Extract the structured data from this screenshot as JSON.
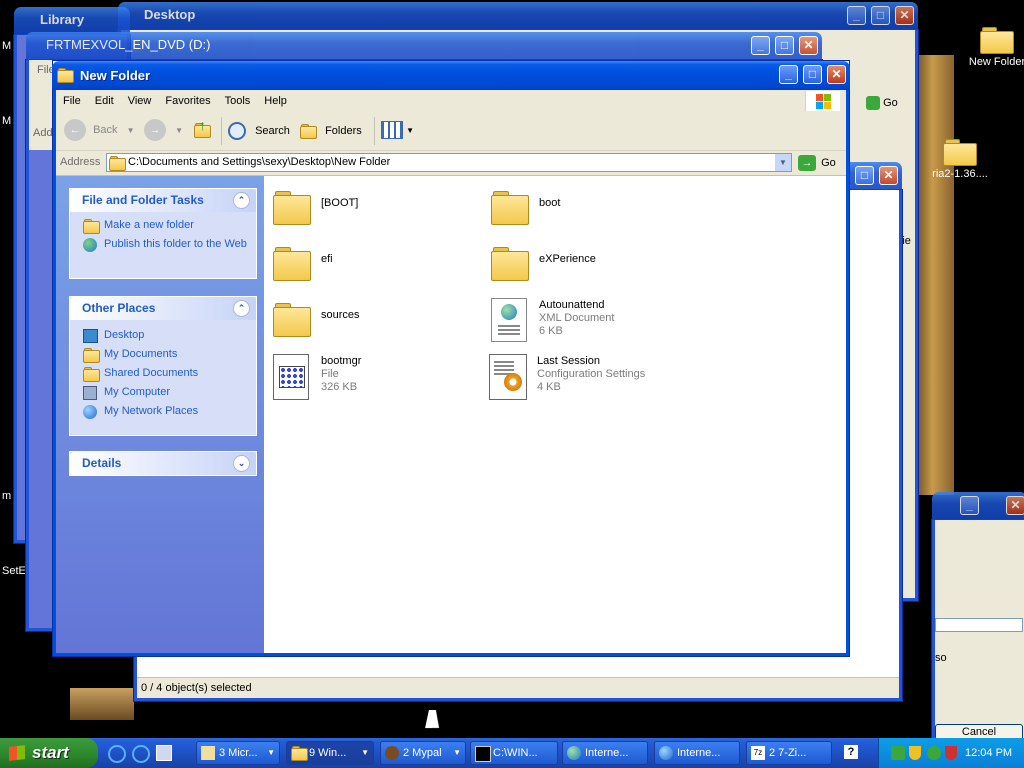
{
  "desktop": {
    "icons": [
      {
        "label": "New Folder"
      },
      {
        "label": "ria2-1.36...."
      }
    ],
    "fragments": {
      "m1": "M",
      "m2": "M",
      "m3": "m",
      "s1": "SetE",
      "s2": "so",
      "s3": "rrie"
    }
  },
  "bg_windows": {
    "library": {
      "title": "Library"
    },
    "desktop": {
      "title": "Desktop",
      "go": "Go"
    },
    "dvd": {
      "title": "FRTMEXVOL_EN_DVD (D:)",
      "menu_fragment": "File",
      "addr_fragment": "Add"
    },
    "lower": {
      "status": "0 / 4 object(s) selected",
      "cancel": "Cancel"
    }
  },
  "window": {
    "title": "New Folder",
    "menu": [
      "File",
      "Edit",
      "View",
      "Favorites",
      "Tools",
      "Help"
    ],
    "toolbar": {
      "back": "Back",
      "search": "Search",
      "folders": "Folders"
    },
    "address": {
      "label": "Address",
      "value": "C:\\Documents and Settings\\sexy\\Desktop\\New Folder",
      "go": "Go"
    },
    "tasks": {
      "file_folder": {
        "title": "File and Folder Tasks",
        "items": [
          "Make a new folder",
          "Publish this folder to the Web"
        ]
      },
      "other_places": {
        "title": "Other Places",
        "items": [
          "Desktop",
          "My Documents",
          "Shared Documents",
          "My Computer",
          "My Network Places"
        ]
      },
      "details": {
        "title": "Details"
      }
    },
    "files": [
      {
        "name": "[BOOT]",
        "type": "",
        "size": ""
      },
      {
        "name": "boot",
        "type": "",
        "size": ""
      },
      {
        "name": "efi",
        "type": "",
        "size": ""
      },
      {
        "name": "eXPerience",
        "type": "",
        "size": ""
      },
      {
        "name": "sources",
        "type": "",
        "size": ""
      },
      {
        "name": "Autounattend",
        "type": "XML Document",
        "size": "6 KB"
      },
      {
        "name": "bootmgr",
        "type": "File",
        "size": "326 KB"
      },
      {
        "name": "Last Session",
        "type": "Configuration Settings",
        "size": "4 KB"
      }
    ]
  },
  "taskbar": {
    "start": "start",
    "buttons": [
      "3 Micr...",
      "9 Win...",
      "2 Mypal",
      "C:\\WIN...",
      "Interne...",
      "Interne...",
      "2 7-Zi..."
    ],
    "clock": "12:04 PM"
  },
  "colors": {
    "xp_blue": "#0050e0",
    "task_pane": "#6375d6",
    "taskbar": "#245edb",
    "start_green": "#2f8a2f"
  }
}
